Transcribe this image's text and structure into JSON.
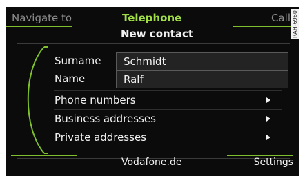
{
  "tabs": {
    "left": "Navigate to",
    "center": "Telephone",
    "right": "Call"
  },
  "subtitle": "New contact",
  "watermark": "RAH-6960",
  "fields": [
    {
      "label": "Surname",
      "value": "Schmidt"
    },
    {
      "label": "Name",
      "value": "Ralf"
    }
  ],
  "menu_items": [
    "Phone numbers",
    "Business addresses",
    "Private addresses"
  ],
  "footer": {
    "left": "Vodafone.de",
    "right": "Settings"
  },
  "colors": {
    "accent": "#7fbf2e",
    "active_tab": "#9fdc45",
    "inactive_tab": "#8c8c8c",
    "text": "#f2f2f2",
    "background": "#0b0b0b"
  },
  "icons": {
    "menu_arrow": "chevron-right-icon",
    "scroll": "scroll-down-icon"
  }
}
